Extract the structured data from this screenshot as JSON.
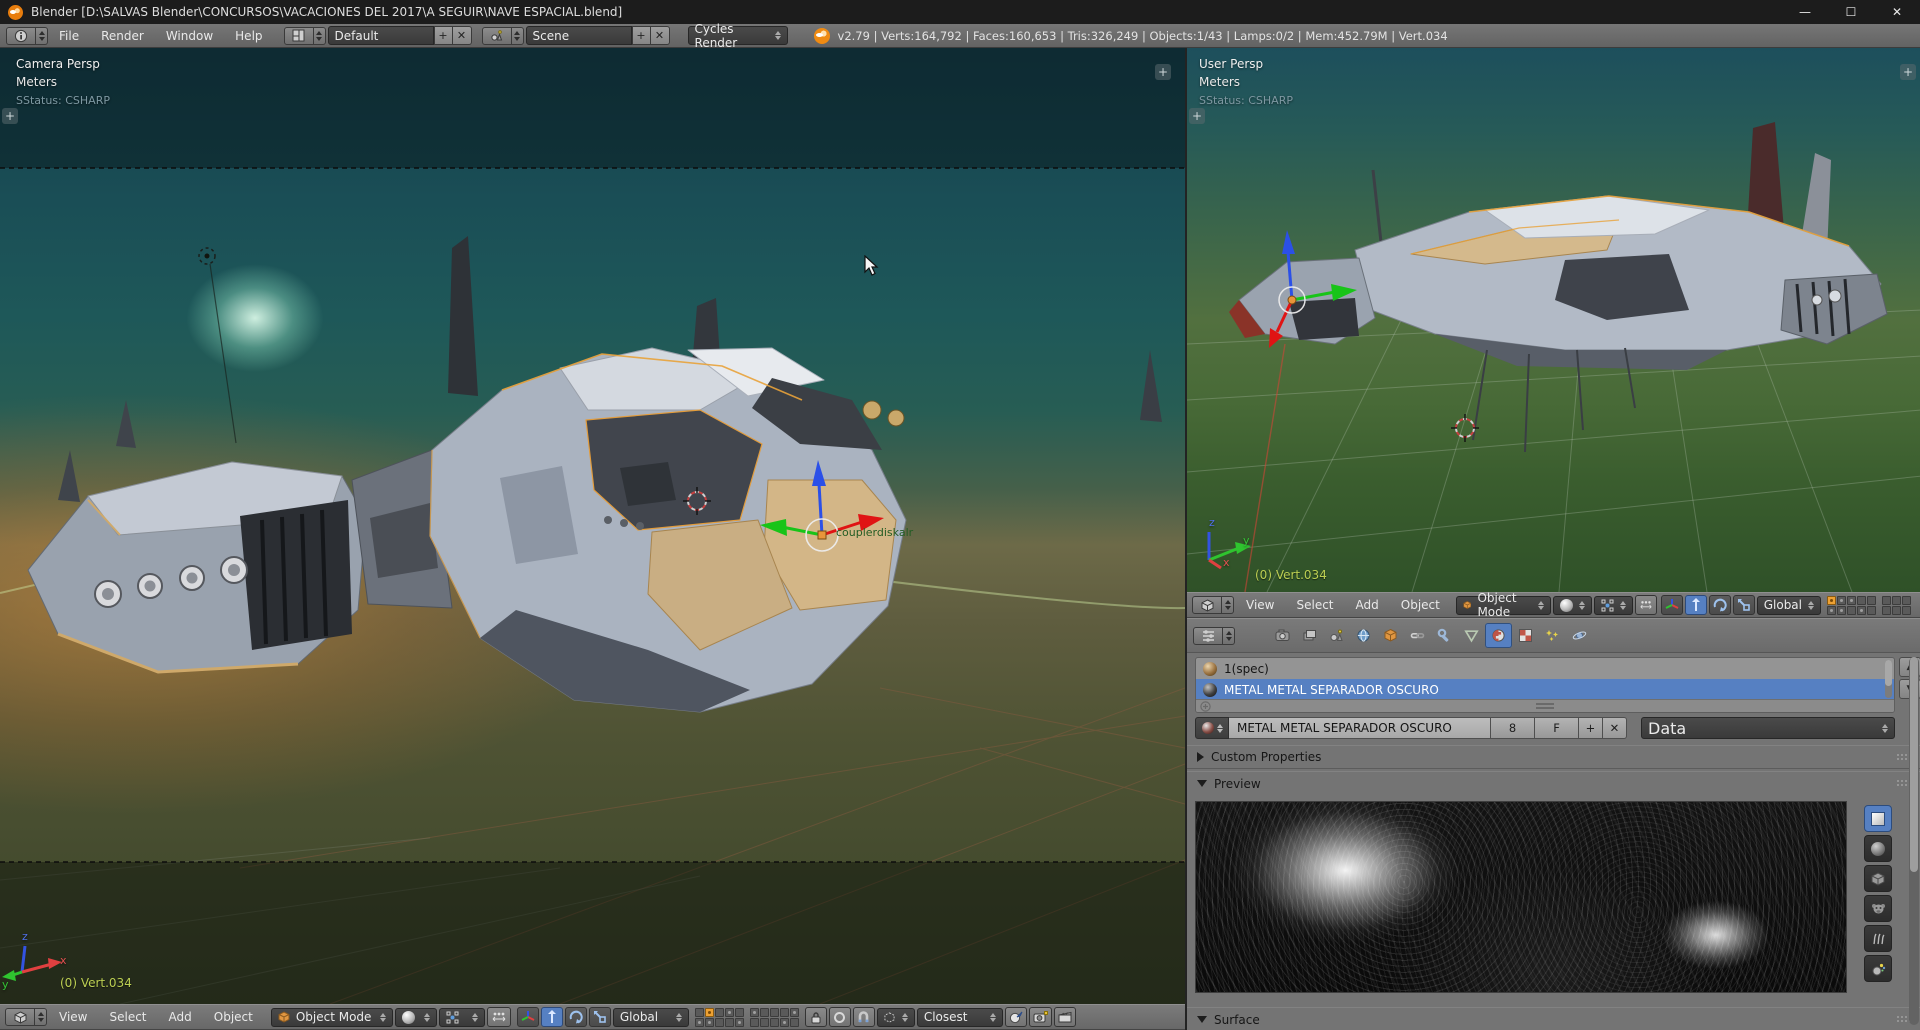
{
  "window": {
    "title": "Blender [D:\\SALVAS Blender\\CONCURSOS\\VACACIONES DEL 2017\\A SEGUIR\\NAVE ESPACIAL.blend]",
    "minimize": "—",
    "maximize": "☐",
    "close": "✕"
  },
  "topbar": {
    "menus": [
      "File",
      "Render",
      "Window",
      "Help"
    ],
    "layout_value": "Default",
    "layout_add": "+",
    "layout_close": "✕",
    "scene_value": "Scene",
    "scene_add": "+",
    "scene_close": "✕",
    "engine_value": "Cycles Render",
    "stats": "v2.79 | Verts:164,792 | Faces:160,653 | Tris:326,249 | Objects:1/43 | Lamps:0/2 | Mem:452.79M | Vert.034"
  },
  "left_viewport": {
    "view_label": "Camera Persp",
    "units_label": "Meters",
    "sstatus": "SStatus: CSHARP",
    "frame_label": "(0) Vert.034",
    "object_name": "couplerdiskalr",
    "axis": {
      "x": "x",
      "y": "y",
      "z": "z"
    },
    "header": {
      "menus": [
        "View",
        "Select",
        "Add",
        "Object"
      ],
      "mode": "Object Mode",
      "orientation": "Global",
      "snap_target": "Closest"
    }
  },
  "right_viewport": {
    "view_label": "User Persp",
    "units_label": "Meters",
    "sstatus": "SStatus: CSHARP",
    "frame_label": "(0) Vert.034",
    "axis": {
      "x": "x",
      "y": "y",
      "z": "z"
    },
    "header": {
      "menus": [
        "View",
        "Select",
        "Add",
        "Object"
      ],
      "mode": "Object Mode",
      "orientation": "Global"
    }
  },
  "properties": {
    "tabs": [
      "render",
      "render-layers",
      "scene",
      "world",
      "object",
      "constraints",
      "modifiers",
      "object-data",
      "material",
      "texture",
      "particles",
      "physics"
    ],
    "active_tab": "material",
    "slots": [
      {
        "name": "1(spec)"
      },
      {
        "name": "METAL METAL SEPARADOR OSCURO"
      }
    ],
    "slot_scroll_up": "▲",
    "slot_scroll_down": "▼",
    "datablock": {
      "name": "METAL METAL SEPARADOR OSCURO",
      "users": "8",
      "fake_user": "F",
      "add": "+",
      "unlink": "✕",
      "source": "Data"
    },
    "panels": {
      "custom_properties": "Custom Properties",
      "preview": "Preview",
      "surface": "Surface"
    }
  },
  "colors": {
    "selection_blue": "#5680c2",
    "layer_active_orange": "#eda133",
    "selection_outline_orange": "#e8a23a",
    "axis_x": "#e04040",
    "axis_y": "#2fc42f",
    "axis_z": "#3353e2"
  }
}
